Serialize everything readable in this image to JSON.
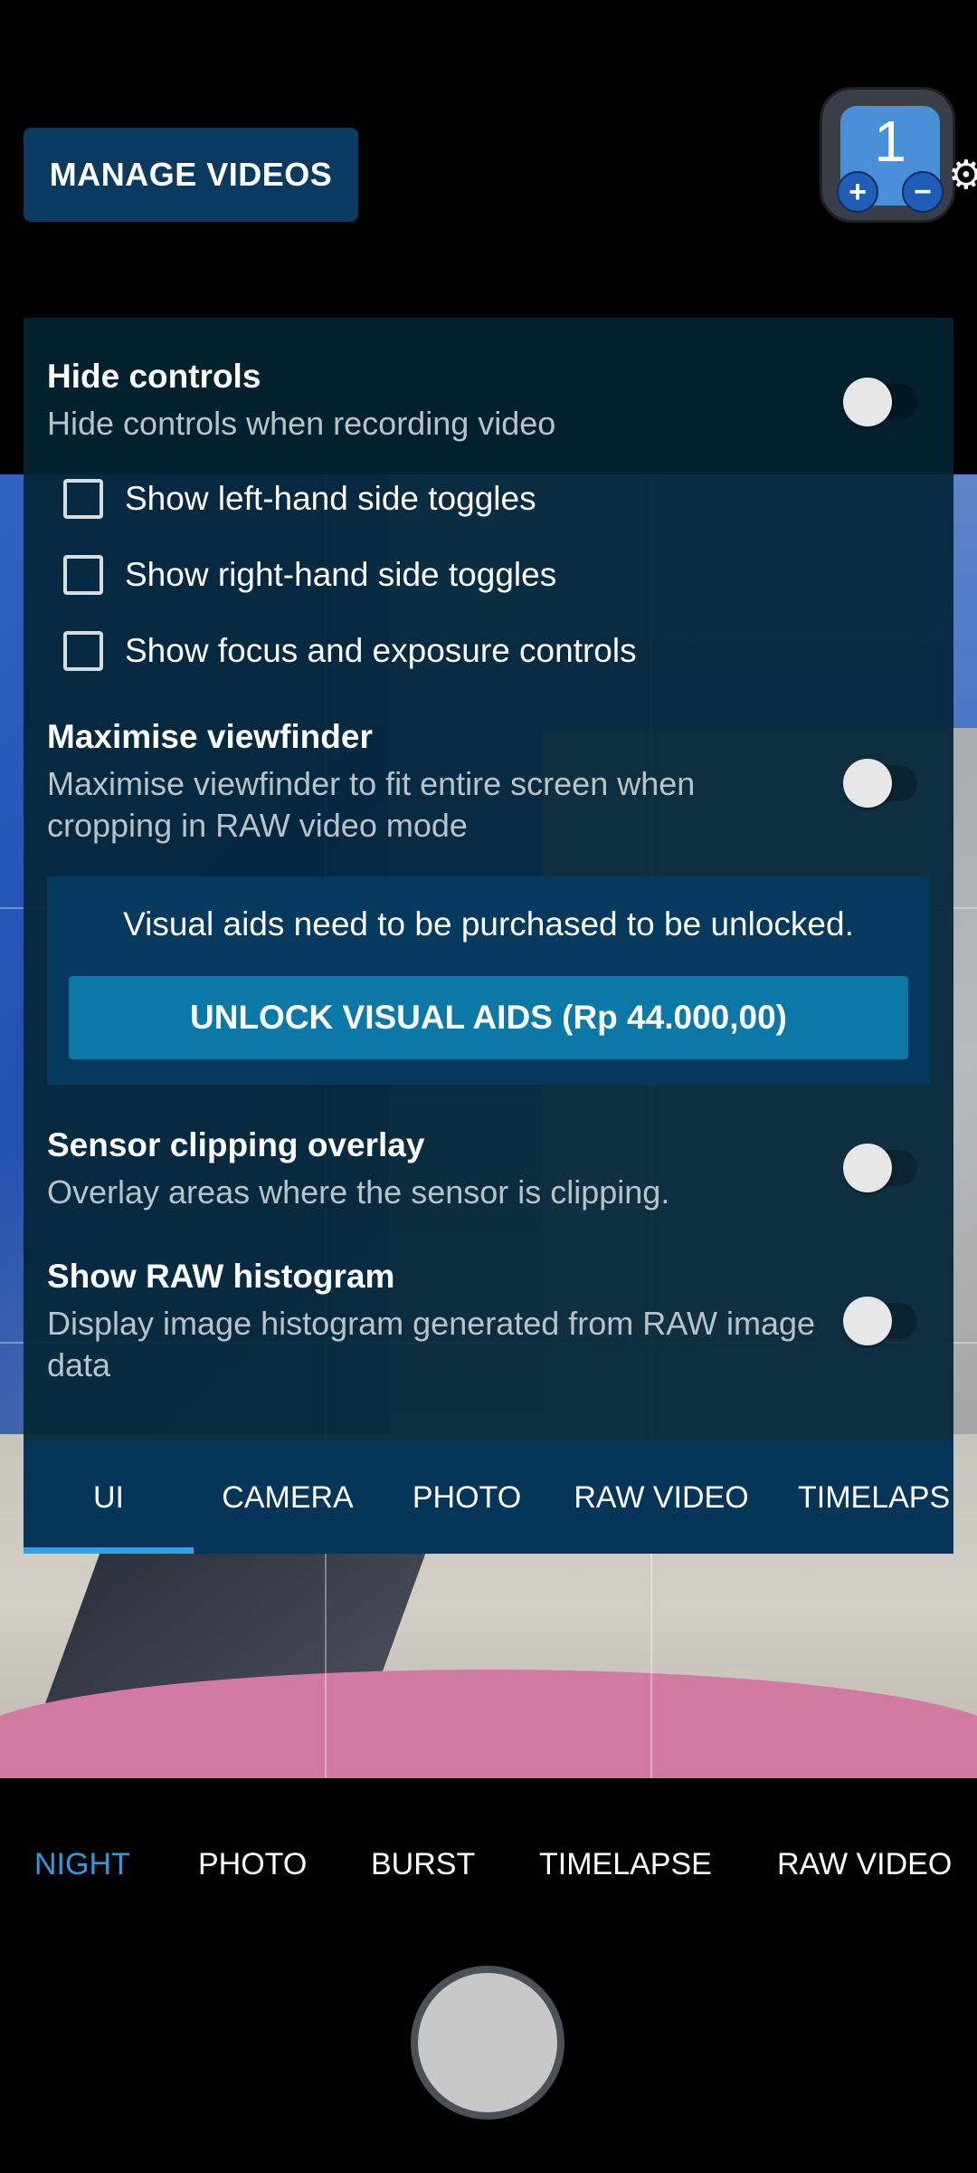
{
  "top": {
    "manage_videos": "MANAGE VIDEOS",
    "counter": {
      "value": "1",
      "plus": "+",
      "minus": "−"
    }
  },
  "settings": {
    "hide_controls": {
      "title": "Hide controls",
      "subtitle": "Hide controls when recording video",
      "enabled": false
    },
    "checkboxes": [
      {
        "label": "Show left-hand side toggles",
        "checked": false
      },
      {
        "label": "Show right-hand side toggles",
        "checked": false
      },
      {
        "label": "Show focus and exposure controls",
        "checked": false
      }
    ],
    "maximise_viewfinder": {
      "title": "Maximise viewfinder",
      "subtitle": "Maximise viewfinder to fit entire screen when cropping in RAW video mode",
      "enabled": false
    },
    "visual_aids": {
      "message": "Visual aids need to be purchased to be unlocked.",
      "unlock_button": "UNLOCK VISUAL AIDS (Rp 44.000,00)"
    },
    "sensor_clipping": {
      "title": "Sensor clipping overlay",
      "subtitle": "Overlay areas where the sensor is clipping.",
      "enabled": false
    },
    "raw_histogram": {
      "title": "Show RAW histogram",
      "subtitle": "Display image histogram generated from RAW image data",
      "enabled": false
    }
  },
  "tabs": {
    "items": [
      "UI",
      "CAMERA",
      "PHOTO",
      "RAW VIDEO",
      "TIMELAPS"
    ],
    "active": "UI"
  },
  "modes": {
    "items": [
      "NIGHT",
      "PHOTO",
      "BURST",
      "TIMELAPSE",
      "RAW VIDEO"
    ],
    "active": "NIGHT"
  },
  "colors": {
    "accent": "#2a9de0",
    "panel": "#02263a",
    "button": "#0b78a8"
  }
}
